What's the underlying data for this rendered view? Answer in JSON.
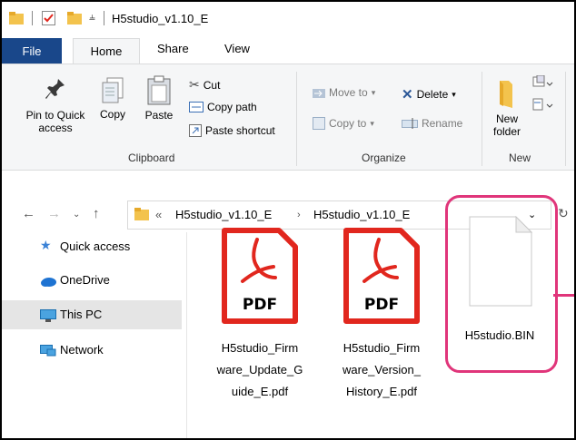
{
  "window": {
    "title": "H5studio_v1.10_E"
  },
  "tabs": {
    "file": "File",
    "home": "Home",
    "share": "Share",
    "view": "View"
  },
  "ribbon": {
    "pin_to_quick_access": "Pin to Quick access",
    "copy": "Copy",
    "paste": "Paste",
    "cut": "Cut",
    "copy_path": "Copy path",
    "paste_shortcut": "Paste shortcut",
    "clipboard_group": "Clipboard",
    "move_to": "Move to",
    "copy_to": "Copy to",
    "delete": "Delete",
    "rename": "Rename",
    "organize_group": "Organize",
    "new_folder": "New folder",
    "new_group": "New"
  },
  "address": {
    "overflow": "«",
    "crumbs": [
      "H5studio_v1.10_E",
      "H5studio_v1.10_E"
    ]
  },
  "nav_pane": {
    "items": [
      "Quick access",
      "OneDrive",
      "This PC",
      "Network"
    ]
  },
  "files": [
    {
      "name_lines": [
        "H5studio_Firm",
        "ware_Update_G",
        "uide_E.pdf"
      ],
      "type": "pdf",
      "badge": "PDF"
    },
    {
      "name_lines": [
        "H5studio_Firm",
        "ware_Version_",
        "History_E.pdf"
      ],
      "type": "pdf",
      "badge": "PDF"
    },
    {
      "name_lines": [
        "H5studio.BIN"
      ],
      "type": "bin"
    }
  ],
  "colors": {
    "file_tab": "#19478a",
    "highlight": "#e0357a",
    "pdf_red": "#e1271e",
    "selected_nav": "#cce8ff"
  }
}
